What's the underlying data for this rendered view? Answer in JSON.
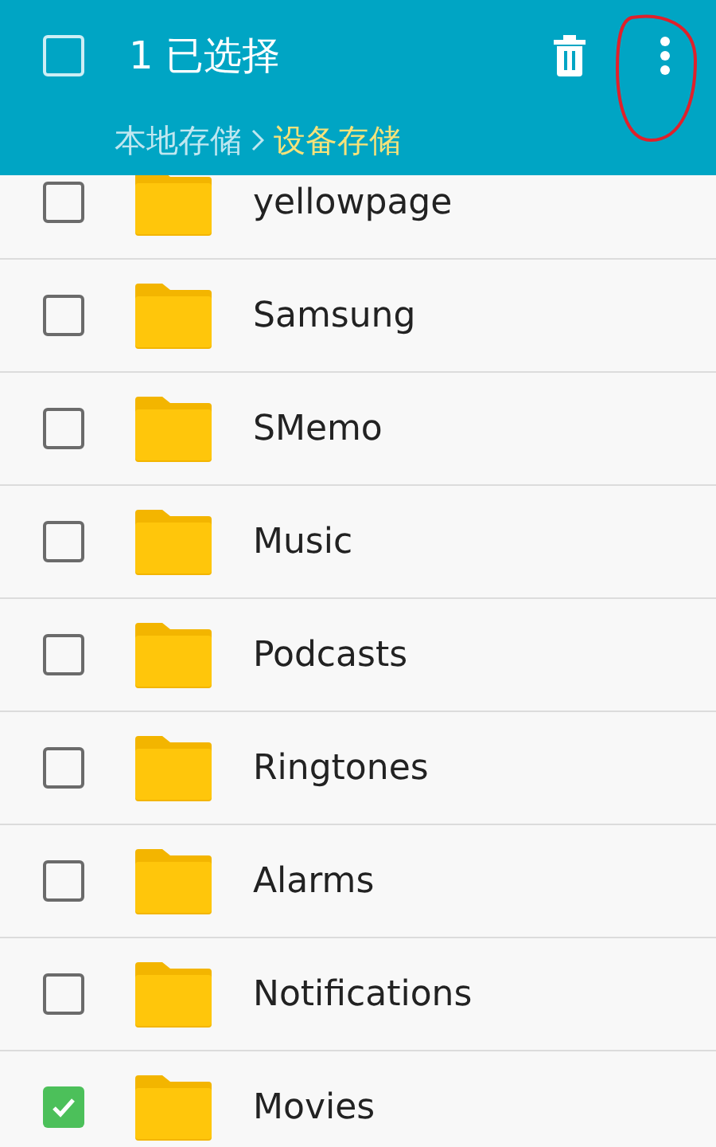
{
  "header": {
    "select_all_checked": false,
    "title": "1 已选择"
  },
  "breadcrumb": [
    {
      "label": "本地存储",
      "selected": false
    },
    {
      "label": "设备存储",
      "selected": true
    }
  ],
  "folders": [
    {
      "name": "yellowpage",
      "checked": false
    },
    {
      "name": "Samsung",
      "checked": false
    },
    {
      "name": "SMemo",
      "checked": false
    },
    {
      "name": "Music",
      "checked": false
    },
    {
      "name": "Podcasts",
      "checked": false
    },
    {
      "name": "Ringtones",
      "checked": false
    },
    {
      "name": "Alarms",
      "checked": false
    },
    {
      "name": "Notifications",
      "checked": false
    },
    {
      "name": "Movies",
      "checked": true
    }
  ]
}
